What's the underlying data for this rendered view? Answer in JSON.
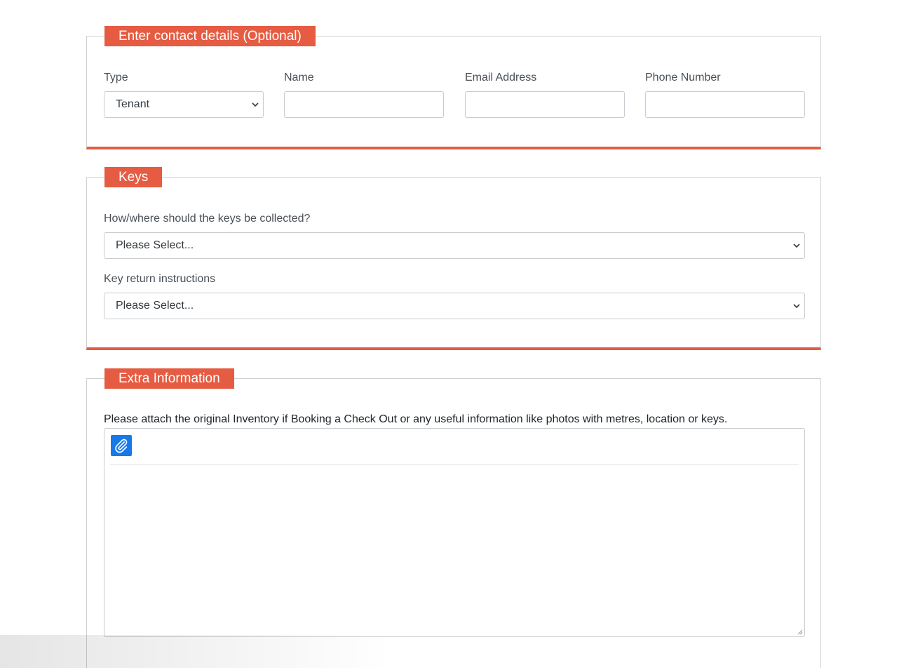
{
  "colors": {
    "accent": "#e55c43",
    "attach_button": "#1778e8",
    "border": "#d0d0d0"
  },
  "contact": {
    "title": "Enter contact details (Optional)",
    "type_label": "Type",
    "type_value": "Tenant",
    "name_label": "Name",
    "name_value": "",
    "email_label": "Email Address",
    "email_value": "",
    "phone_label": "Phone Number",
    "phone_value": ""
  },
  "keys": {
    "title": "Keys",
    "collect_label": "How/where should the keys be collected?",
    "collect_value": "Please Select...",
    "return_label": "Key return instructions",
    "return_value": "Please Select..."
  },
  "extra": {
    "title": "Extra Information",
    "hint": "Please attach the original Inventory if Booking a Check Out or any useful information like photos with metres, location or keys.",
    "attach_icon": "paperclip-icon",
    "editor_value": ""
  }
}
